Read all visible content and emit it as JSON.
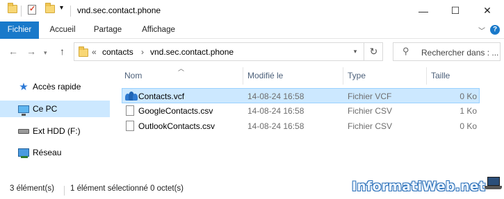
{
  "window": {
    "title": "vnd.sec.contact.phone",
    "controls": [
      "minimize",
      "maximize",
      "close"
    ]
  },
  "ribbon": {
    "tabs": [
      "Fichier",
      "Accueil",
      "Partage",
      "Affichage"
    ],
    "help": "?"
  },
  "address": {
    "overflow": "«",
    "crumbs": [
      "contacts",
      "vnd.sec.contact.phone"
    ],
    "separator": "›"
  },
  "search": {
    "placeholder": "Rechercher dans : ..."
  },
  "navpane": {
    "items": [
      {
        "label": "Accès rapide",
        "icon": "star-icon"
      },
      {
        "label": "Ce PC",
        "icon": "computer-icon",
        "selected": true
      },
      {
        "label": "Ext HDD (F:)",
        "icon": "drive-icon"
      },
      {
        "label": "Réseau",
        "icon": "network-icon"
      }
    ]
  },
  "columns": [
    "Nom",
    "Modifié le",
    "Type",
    "Taille"
  ],
  "files": [
    {
      "name": "Contacts.vcf",
      "modified": "14-08-24 16:58",
      "type": "Fichier VCF",
      "size": "0 Ko",
      "icon": "contacts-file-icon",
      "selected": true
    },
    {
      "name": "GoogleContacts.csv",
      "modified": "14-08-24 16:58",
      "type": "Fichier CSV",
      "size": "1 Ko",
      "icon": "document-icon"
    },
    {
      "name": "OutlookContacts.csv",
      "modified": "14-08-24 16:58",
      "type": "Fichier CSV",
      "size": "0 Ko",
      "icon": "document-icon"
    }
  ],
  "status": {
    "count": "3 élément(s)",
    "selection": "1 élément sélectionné  0 octet(s)"
  },
  "watermark": "InformatiWeb.net",
  "colors": {
    "accent": "#1979ca",
    "selection": "#cce8ff",
    "header_text": "#4c607a"
  }
}
